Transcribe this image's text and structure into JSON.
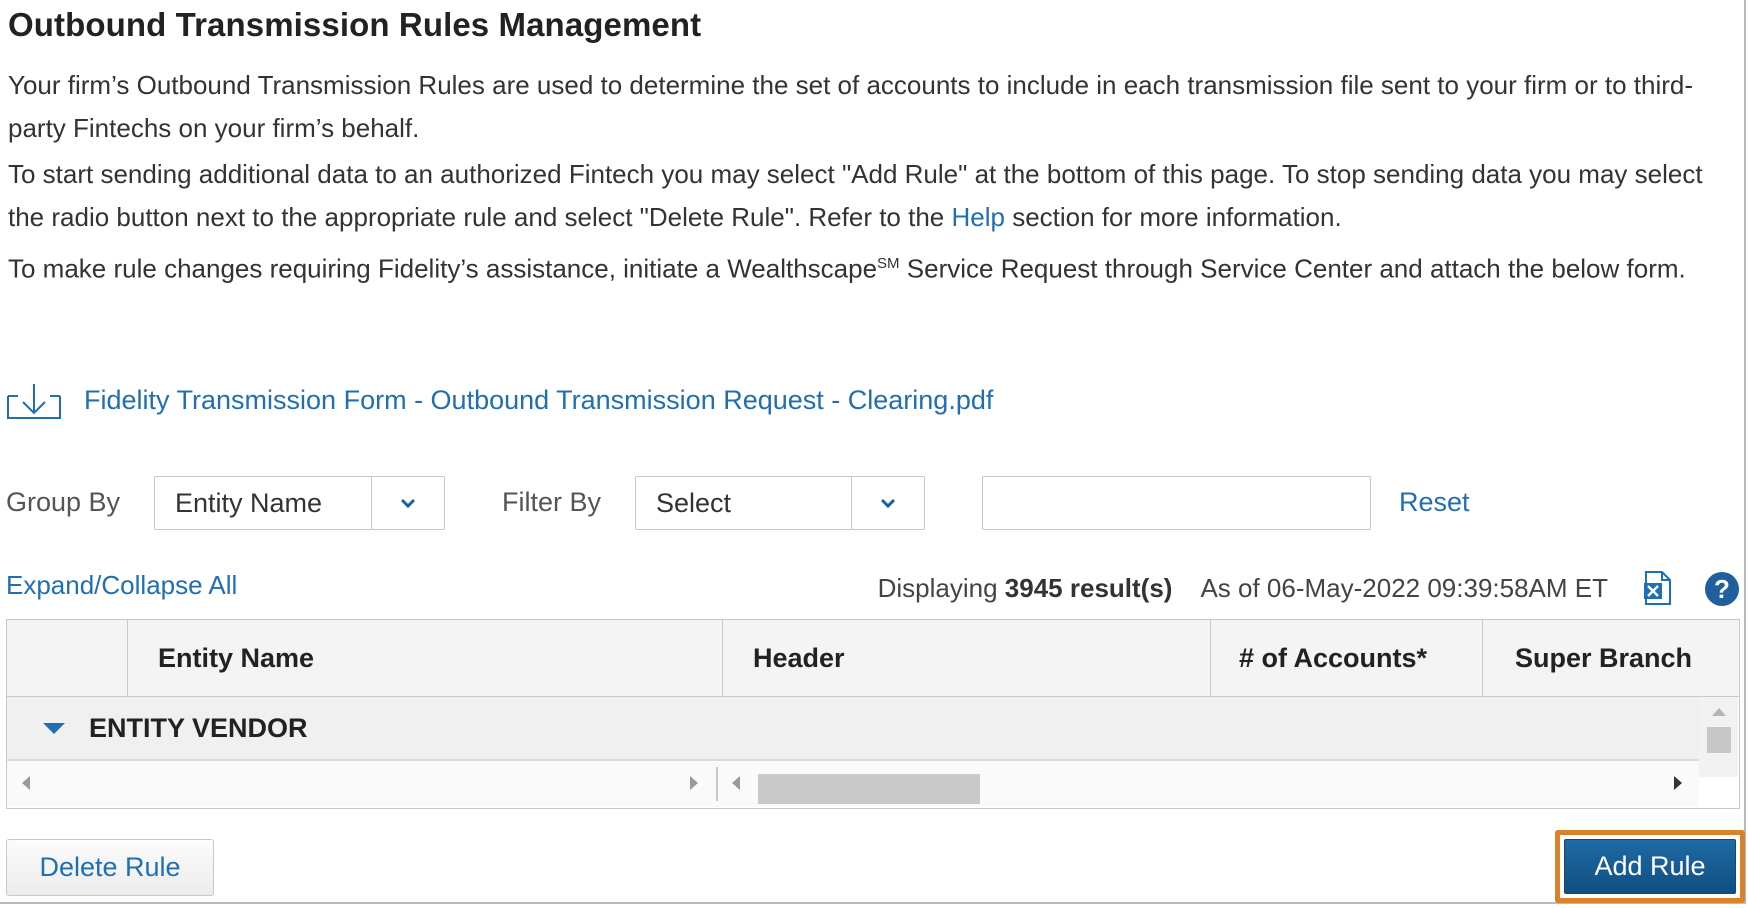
{
  "title": "Outbound Transmission Rules Management",
  "intro": {
    "p1": "Your firm’s Outbound Transmission Rules are used to determine the set of accounts to include in each transmission file sent to your firm or to third-party Fintechs on your firm’s behalf.",
    "p2_before": "To start sending additional data to an authorized Fintech you may select \"Add Rule\" at the bottom of this page. To stop sending data you may select the radio button next to the appropriate rule and select \"Delete Rule\". Refer to the ",
    "p2_link": "Help",
    "p2_after": " section for more information.",
    "p3_before": "To make rule changes requiring Fidelity’s assistance, initiate a Wealthscape",
    "p3_sup": "SM",
    "p3_after": " Service Request through Service Center and attach the below form."
  },
  "download": {
    "icon": "download-icon",
    "label": "Fidelity Transmission Form - Outbound Transmission Request - Clearing.pdf"
  },
  "controls": {
    "group_by_label": "Group By",
    "group_by_value": "Entity Name",
    "filter_by_label": "Filter By",
    "filter_by_value": "Select",
    "filter_text_value": "",
    "reset_label": "Reset"
  },
  "results": {
    "expand_collapse_label": "Expand/Collapse All",
    "displaying_prefix": "Displaying ",
    "count_text": "3945 result(s)",
    "as_of": "As of 06-May-2022 09:39:58AM ET"
  },
  "grid": {
    "columns": [
      "",
      "Entity Name",
      "Header",
      "# of Accounts*",
      "Super Branch"
    ],
    "groups": [
      {
        "label": "ENTITY VENDOR",
        "expanded": true
      }
    ]
  },
  "buttons": {
    "delete_rule": "Delete Rule",
    "add_rule": "Add Rule"
  },
  "colors": {
    "link": "#1f6fb2",
    "primary_button": "#1f6aa4",
    "highlight_outline": "#d9822b",
    "help_icon": "#1f5f9e",
    "excel_icon": "#1e6fb8"
  }
}
